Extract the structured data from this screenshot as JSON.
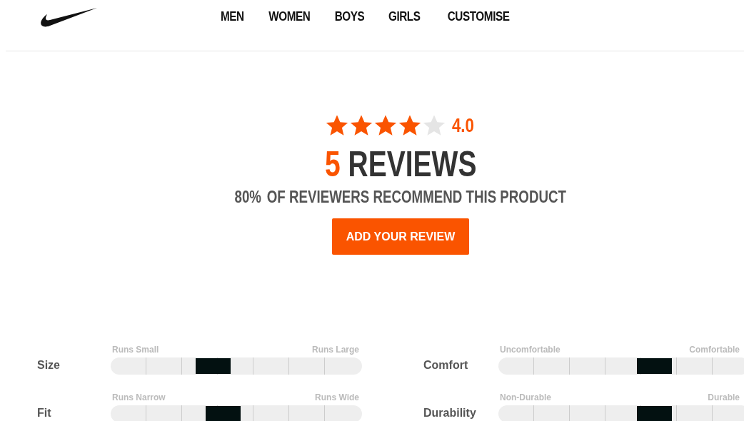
{
  "nav": [
    {
      "label": "MEN"
    },
    {
      "label": "WOMEN"
    },
    {
      "label": "BOYS"
    },
    {
      "label": "GIRLS"
    },
    {
      "label": "CUSTOMISE"
    }
  ],
  "summary": {
    "stars": 4,
    "rating": "4.0",
    "count": "5",
    "count_label": "REVIEWS",
    "recommend_percent": "80%",
    "recommend_text": "OF REVIEWERS RECOMMEND THIS PRODUCT",
    "button": "ADD YOUR REVIEW"
  },
  "ratings": [
    {
      "name": "Size",
      "low": "Runs Small",
      "high": "Runs Large",
      "level": 0.405
    },
    {
      "name": "Comfort",
      "low": "Uncomfortable",
      "high": "Comfortable",
      "level": 0.62
    },
    {
      "name": "Fit",
      "low": "Runs Narrow",
      "high": "Runs Wide",
      "level": 0.445
    },
    {
      "name": "Durability",
      "low": "Non-Durable",
      "high": "Durable",
      "level": 0.62
    }
  ]
}
